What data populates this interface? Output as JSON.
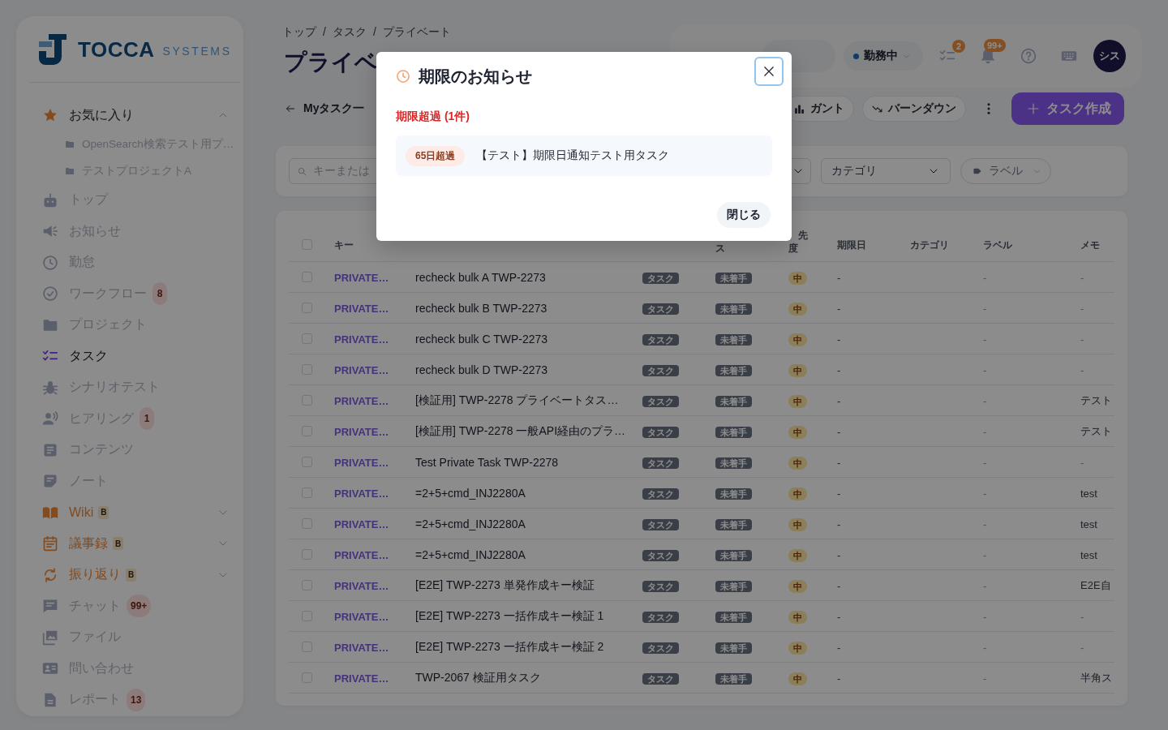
{
  "sidebar": {
    "logo": {
      "name": "TOCCA",
      "suffix": "SYSTEMS"
    },
    "favorites": {
      "label": "お気に入り",
      "expanded": true,
      "items": [
        "OpenSearch検索テスト用プ…",
        "テストプロジェクトA"
      ]
    },
    "items": [
      {
        "label": "トップ",
        "kind": "link",
        "selected": false
      },
      {
        "label": "お知らせ",
        "kind": "link",
        "selected": false
      },
      {
        "label": "勤怠",
        "kind": "link",
        "selected": false
      },
      {
        "label": "ワークフロー",
        "kind": "link",
        "selected": false,
        "badge": "8"
      },
      {
        "label": "プロジェクト",
        "kind": "link",
        "selected": false
      },
      {
        "label": "タスク",
        "kind": "link",
        "selected": true
      },
      {
        "label": "シナリオテスト",
        "kind": "link",
        "selected": false
      },
      {
        "label": "ヒアリング",
        "kind": "link",
        "selected": false,
        "badge": "1"
      },
      {
        "label": "コンテンツ",
        "kind": "link",
        "selected": false
      },
      {
        "label": "ノート",
        "kind": "link",
        "selected": false
      },
      {
        "label": "Wiki",
        "kind": "group",
        "selected": false,
        "badge": "B",
        "expanded": false
      },
      {
        "label": "議事録",
        "kind": "group",
        "selected": false,
        "badge": "B",
        "expanded": false
      },
      {
        "label": "振り返り",
        "kind": "group",
        "selected": false,
        "badge": "B",
        "expanded": false
      },
      {
        "label": "チャット",
        "kind": "link",
        "selected": false,
        "badge": "99+"
      },
      {
        "label": "ファイル",
        "kind": "link",
        "selected": false
      },
      {
        "label": "問い合わせ",
        "kind": "link",
        "selected": false
      },
      {
        "label": "レポート",
        "kind": "link",
        "selected": false,
        "badge": "13"
      }
    ]
  },
  "header": {
    "breadcrumb": {
      "items": [
        "トップ",
        "タスク",
        "プライベート"
      ],
      "separator": "/"
    },
    "title": "プライベ"
  },
  "toolbar": {
    "status": "勤務中",
    "task_badge": "2",
    "notification_badge": "99+",
    "avatar": "シス"
  },
  "actions": {
    "back_link": "Myタスク一",
    "views": [
      "ガント",
      "バーンダウン"
    ],
    "create_button": "タスク作成"
  },
  "filters": {
    "search": {
      "placeholder": "キーまたは"
    },
    "category": {
      "placeholder": "カテゴリ"
    },
    "label": {
      "placeholder": "ラベル"
    }
  },
  "table": {
    "header_checkbox": {
      "checked": false
    },
    "columns": [
      "キー",
      "ス",
      "先度",
      "期限日",
      "カテゴリ",
      "ラベル",
      "メモ"
    ],
    "rows": [
      {
        "checked": false,
        "key": "PRIVATE…",
        "subject": "recheck bulk A TWP-2273",
        "type": "タスク",
        "status": "未着手",
        "priority": "中",
        "due": "-",
        "label": "-",
        "memo": {
          "text": "-",
          "muted": true
        }
      },
      {
        "checked": false,
        "key": "PRIVATE…",
        "subject": "recheck bulk B TWP-2273",
        "type": "タスク",
        "status": "未着手",
        "priority": "中",
        "due": "-",
        "label": "-",
        "memo": {
          "text": "-",
          "muted": true
        }
      },
      {
        "checked": false,
        "key": "PRIVATE…",
        "subject": "recheck bulk C TWP-2273",
        "type": "タスク",
        "status": "未着手",
        "priority": "中",
        "due": "-",
        "label": "-",
        "memo": {
          "text": "-",
          "muted": true
        }
      },
      {
        "checked": false,
        "key": "PRIVATE…",
        "subject": "recheck bulk D TWP-2273",
        "type": "タスク",
        "status": "未着手",
        "priority": "中",
        "due": "-",
        "label": "-",
        "memo": {
          "text": "-",
          "muted": true
        }
      },
      {
        "checked": false,
        "key": "PRIVATE…",
        "subject": "[検証用] TWP-2278 プライベートタス…",
        "type": "タスク",
        "status": "未着手",
        "priority": "中",
        "due": "-",
        "label": "-",
        "memo": {
          "text": "テスト",
          "muted": false
        }
      },
      {
        "checked": false,
        "key": "PRIVATE…",
        "subject": "[検証用] TWP-2278 一般API経由のプラ…",
        "type": "タスク",
        "status": "未着手",
        "priority": "中",
        "due": "-",
        "label": "-",
        "memo": {
          "text": "テスト",
          "muted": false
        }
      },
      {
        "checked": false,
        "key": "PRIVATE…",
        "subject": "Test Private Task TWP-2278",
        "type": "タスク",
        "status": "未着手",
        "priority": "中",
        "due": "-",
        "label": "-",
        "memo": {
          "text": "-",
          "muted": true
        }
      },
      {
        "checked": false,
        "key": "PRIVATE…",
        "subject": "=2+5+cmd_INJ2280A",
        "type": "タスク",
        "status": "未着手",
        "priority": "中",
        "due": "-",
        "label": "-",
        "memo": {
          "text": "test",
          "muted": false
        }
      },
      {
        "checked": false,
        "key": "PRIVATE…",
        "subject": "=2+5+cmd_INJ2280A",
        "type": "タスク",
        "status": "未着手",
        "priority": "中",
        "due": "-",
        "label": "-",
        "memo": {
          "text": "test",
          "muted": false
        }
      },
      {
        "checked": false,
        "key": "PRIVATE…",
        "subject": "=2+5+cmd_INJ2280A",
        "type": "タスク",
        "status": "未着手",
        "priority": "中",
        "due": "-",
        "label": "-",
        "memo": {
          "text": "test",
          "muted": false
        }
      },
      {
        "checked": false,
        "key": "PRIVATE…",
        "subject": "[E2E] TWP-2273 単発作成キー検証",
        "type": "タスク",
        "status": "未着手",
        "priority": "中",
        "due": "-",
        "label": "-",
        "memo": {
          "text": "E2E自",
          "muted": false
        }
      },
      {
        "checked": false,
        "key": "PRIVATE…",
        "subject": "[E2E] TWP-2273 一括作成キー検証 1",
        "type": "タスク",
        "status": "未着手",
        "priority": "中",
        "due": "-",
        "label": "-",
        "memo": {
          "text": "-",
          "muted": true
        }
      },
      {
        "checked": false,
        "key": "PRIVATE…",
        "subject": "[E2E] TWP-2273 一括作成キー検証 2",
        "type": "タスク",
        "status": "未着手",
        "priority": "中",
        "due": "-",
        "label": "-",
        "memo": {
          "text": "-",
          "muted": true
        }
      },
      {
        "checked": false,
        "key": "PRIVATE…",
        "subject": "TWP-2067 検証用タスク",
        "type": "タスク",
        "status": "未着手",
        "priority": "中",
        "due": "-",
        "label": "-",
        "memo": {
          "text": "半角ス",
          "muted": false
        }
      }
    ]
  },
  "dialog": {
    "title": "期限のお知らせ",
    "close": {
      "focused": true
    },
    "section": "期限超過 (1件)",
    "items": [
      {
        "badge": "65日超過",
        "title": "【テスト】期限日通知テスト用タスク"
      }
    ],
    "button": "閉じる"
  }
}
